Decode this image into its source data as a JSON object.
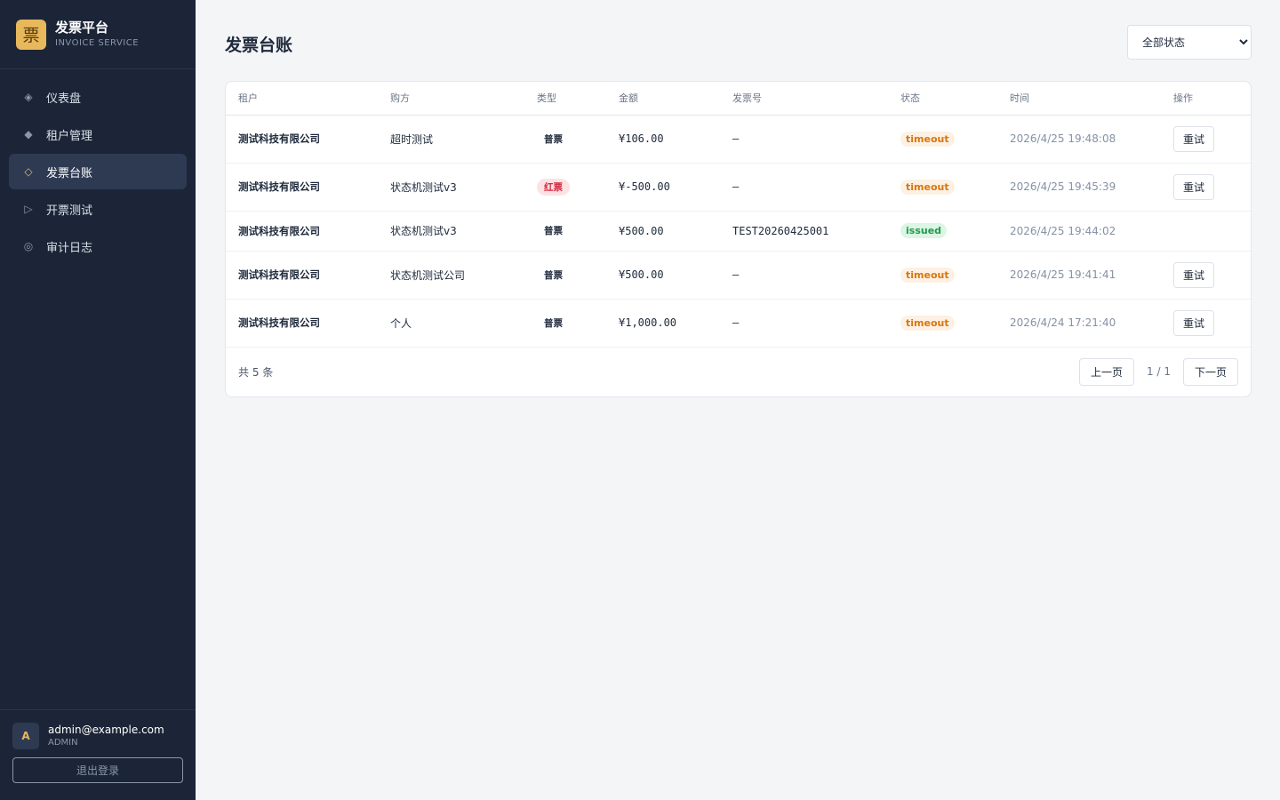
{
  "brand": {
    "logo": "票",
    "title": "发票平台",
    "subtitle": "INVOICE SERVICE"
  },
  "nav": [
    {
      "icon": "◈",
      "icon_name": "dashboard-icon",
      "label": "仪表盘",
      "active": false
    },
    {
      "icon": "◆",
      "icon_name": "tenant-icon",
      "label": "租户管理",
      "active": false
    },
    {
      "icon": "◇",
      "icon_name": "ledger-icon",
      "label": "发票台账",
      "active": true
    },
    {
      "icon": "▷",
      "icon_name": "play-icon",
      "label": "开票测试",
      "active": false
    },
    {
      "icon": "◎",
      "icon_name": "audit-icon",
      "label": "审计日志",
      "active": false
    }
  ],
  "user": {
    "avatar": "A",
    "email": "admin@example.com",
    "role": "ADMIN",
    "logout_label": "退出登录"
  },
  "page": {
    "title": "发票台账"
  },
  "filter": {
    "selected": "全部状态"
  },
  "table": {
    "headers": [
      "租户",
      "购方",
      "类型",
      "金额",
      "发票号",
      "状态",
      "时间",
      "操作"
    ],
    "rows": [
      {
        "tenant": "测试科技有限公司",
        "buyer": "超时测试",
        "type": "普票",
        "type_kind": "normal",
        "amount": "¥106.00",
        "invoice_no": "—",
        "status": "timeout",
        "time": "2026/4/25 19:48:08",
        "action": "重试"
      },
      {
        "tenant": "测试科技有限公司",
        "buyer": "状态机测试v3",
        "type": "红票",
        "type_kind": "red",
        "amount": "¥-500.00",
        "invoice_no": "—",
        "status": "timeout",
        "time": "2026/4/25 19:45:39",
        "action": "重试"
      },
      {
        "tenant": "测试科技有限公司",
        "buyer": "状态机测试v3",
        "type": "普票",
        "type_kind": "normal",
        "amount": "¥500.00",
        "invoice_no": "TEST20260425001",
        "status": "issued",
        "time": "2026/4/25 19:44:02",
        "action": ""
      },
      {
        "tenant": "测试科技有限公司",
        "buyer": "状态机测试公司",
        "type": "普票",
        "type_kind": "normal",
        "amount": "¥500.00",
        "invoice_no": "—",
        "status": "timeout",
        "time": "2026/4/25 19:41:41",
        "action": "重试"
      },
      {
        "tenant": "测试科技有限公司",
        "buyer": "个人",
        "type": "普票",
        "type_kind": "normal",
        "amount": "¥1,000.00",
        "invoice_no": "—",
        "status": "timeout",
        "time": "2026/4/24 17:21:40",
        "action": "重试"
      }
    ]
  },
  "footer": {
    "total": "共 5 条",
    "prev": "上一页",
    "page_info": "1 / 1",
    "next": "下一页"
  },
  "colors": {
    "sidebar_bg": "#1c2537",
    "accent": "#e8b85c",
    "timeout": "#d9760f",
    "issued": "#1f9a4c",
    "red_ticket": "#d1293d"
  }
}
